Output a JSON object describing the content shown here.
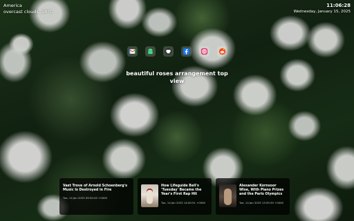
{
  "weather": {
    "location": "America",
    "condition": "overcast clouds, 14°C"
  },
  "clock": {
    "time": "11:06:28",
    "date": "Wednesday, January 15, 2025"
  },
  "shortcuts": [
    {
      "name": "gmail-icon",
      "color": "#EA4335"
    },
    {
      "name": "android-icon",
      "color": "#3DDC84"
    },
    {
      "name": "github-icon",
      "color": "#181717"
    },
    {
      "name": "facebook-icon",
      "color": "#1877F2"
    },
    {
      "name": "instagram-icon",
      "color": "#E1306C"
    },
    {
      "name": "reddit-icon",
      "color": "#FF4500"
    }
  ],
  "photo": {
    "title": "beautiful roses arrangement top view"
  },
  "news": [
    {
      "headline": "Vast Trove of Arnold Schoenberg's Music Is Destroyed in Fire",
      "timestamp": "Tue, 14 Jan 2025 09:50:45 +0000"
    },
    {
      "headline": "How Lifeguide Bell's 'Tuesday' Became the Year's First Rap Hit",
      "timestamp": "Tue, 14 Jan 2025 14:00:51 +0000"
    },
    {
      "headline": "Alexander Kornsoor Wise, With Piano Prizes and the Paris Olympics",
      "timestamp": "Tue, 14 Jan 2025 13:55:55 +0000"
    }
  ]
}
